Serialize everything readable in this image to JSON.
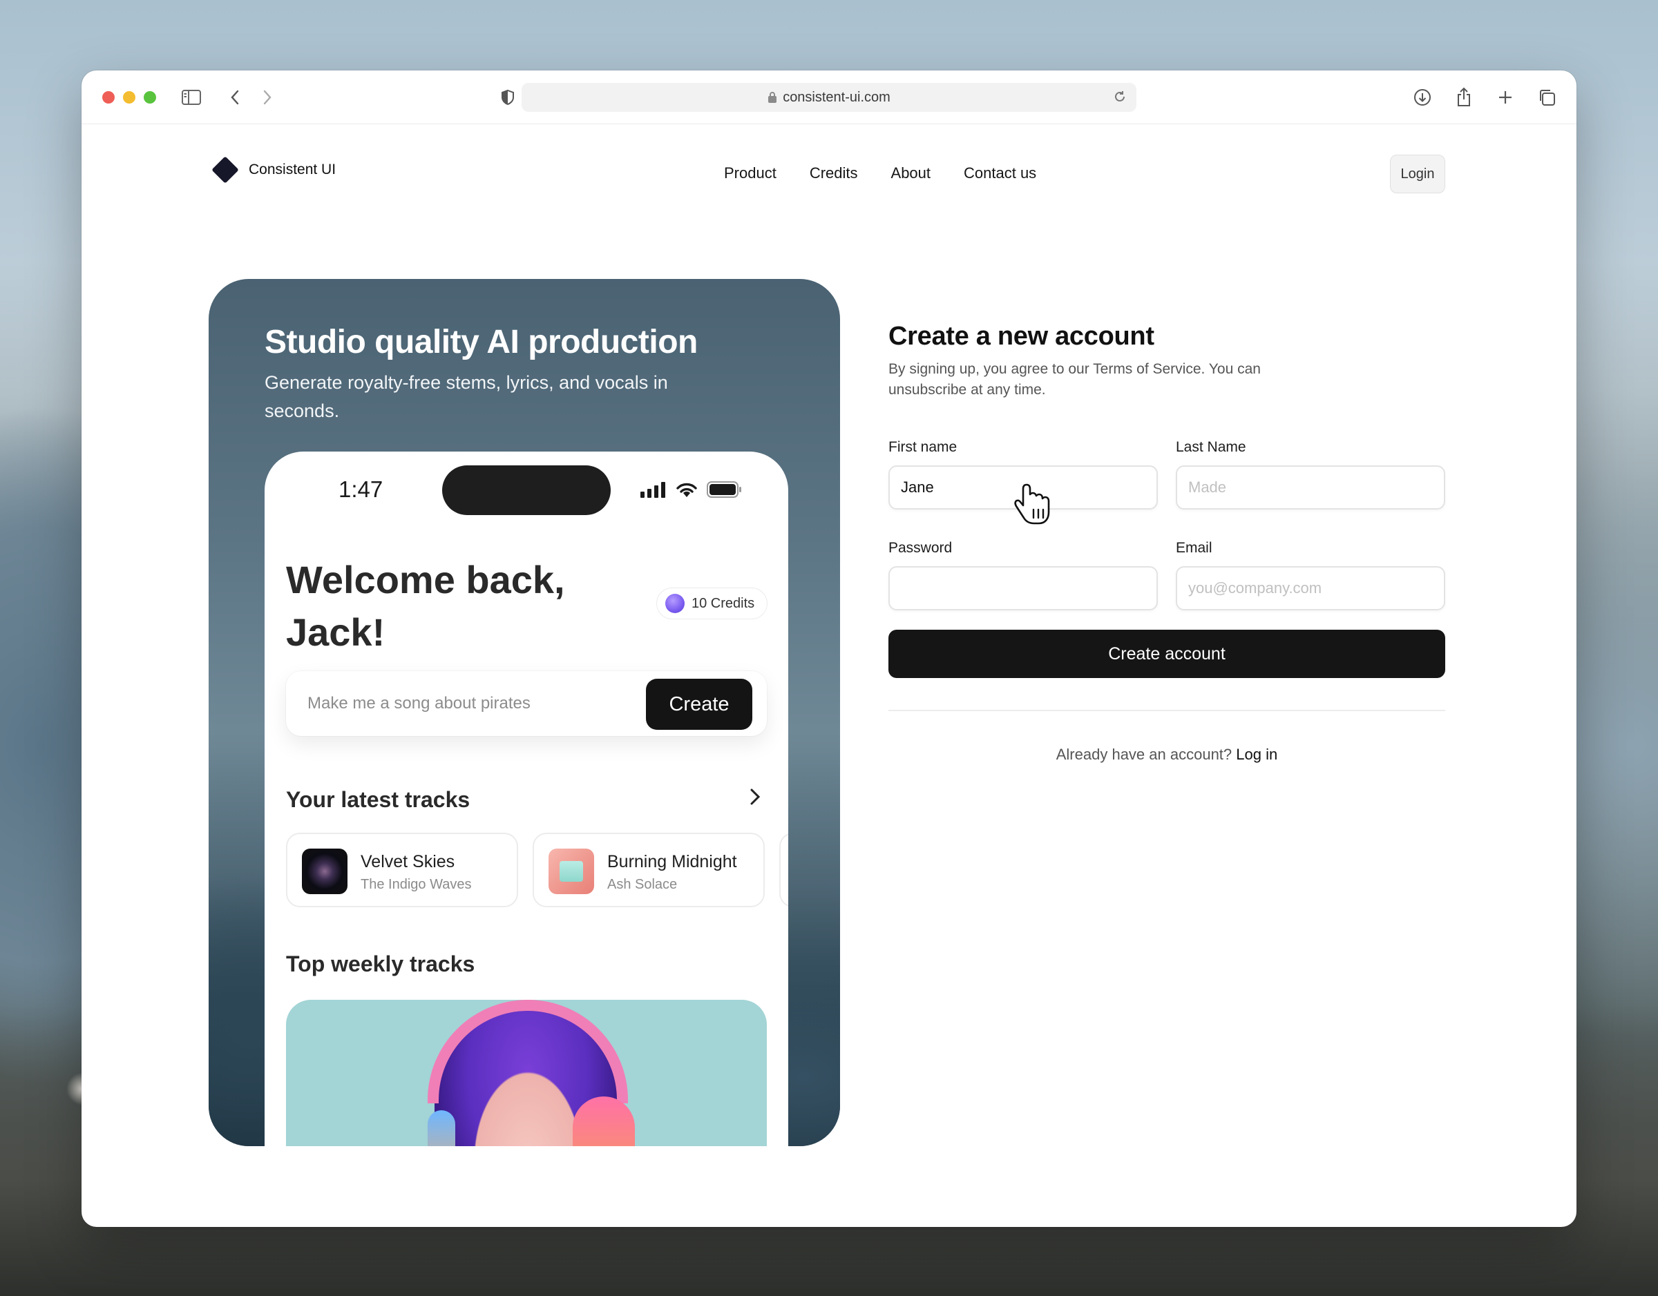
{
  "browser": {
    "url": "consistent-ui.com"
  },
  "site": {
    "brand": "Consistent UI",
    "nav": [
      "Product",
      "Credits",
      "About",
      "Contact us"
    ],
    "login_label": "Login"
  },
  "hero": {
    "title": "Studio quality AI production",
    "subtitle": "Generate royalty-free stems, lyrics, and vocals in seconds."
  },
  "phone": {
    "time": "1:47",
    "welcome": "Welcome back, Jack!",
    "credits": "10 Credits",
    "prompt_placeholder": "Make me a song about pirates",
    "create_label": "Create",
    "latest_title": "Your latest tracks",
    "tracks": [
      {
        "name": "Velvet Skies",
        "artist": "The Indigo Waves"
      },
      {
        "name": "Burning Midnight",
        "artist": "Ash Solace"
      }
    ],
    "weekly_title": "Top weekly tracks"
  },
  "form": {
    "title": "Create a new account",
    "description": "By signing up, you agree to our Terms of Service. You can unsubscribe at any time.",
    "first_name_label": "First name",
    "first_name_value": "Jane",
    "last_name_label": "Last Name",
    "last_name_placeholder": "Made",
    "password_label": "Password",
    "password_value": "",
    "email_label": "Email",
    "email_placeholder": "you@company.com",
    "submit_label": "Create account",
    "already_text": "Already have an account?",
    "login_link": "Log in"
  },
  "colors": {
    "primary_button": "#151515",
    "brand_logo": "#17172a",
    "credit_dot": "#7a5cf0"
  }
}
